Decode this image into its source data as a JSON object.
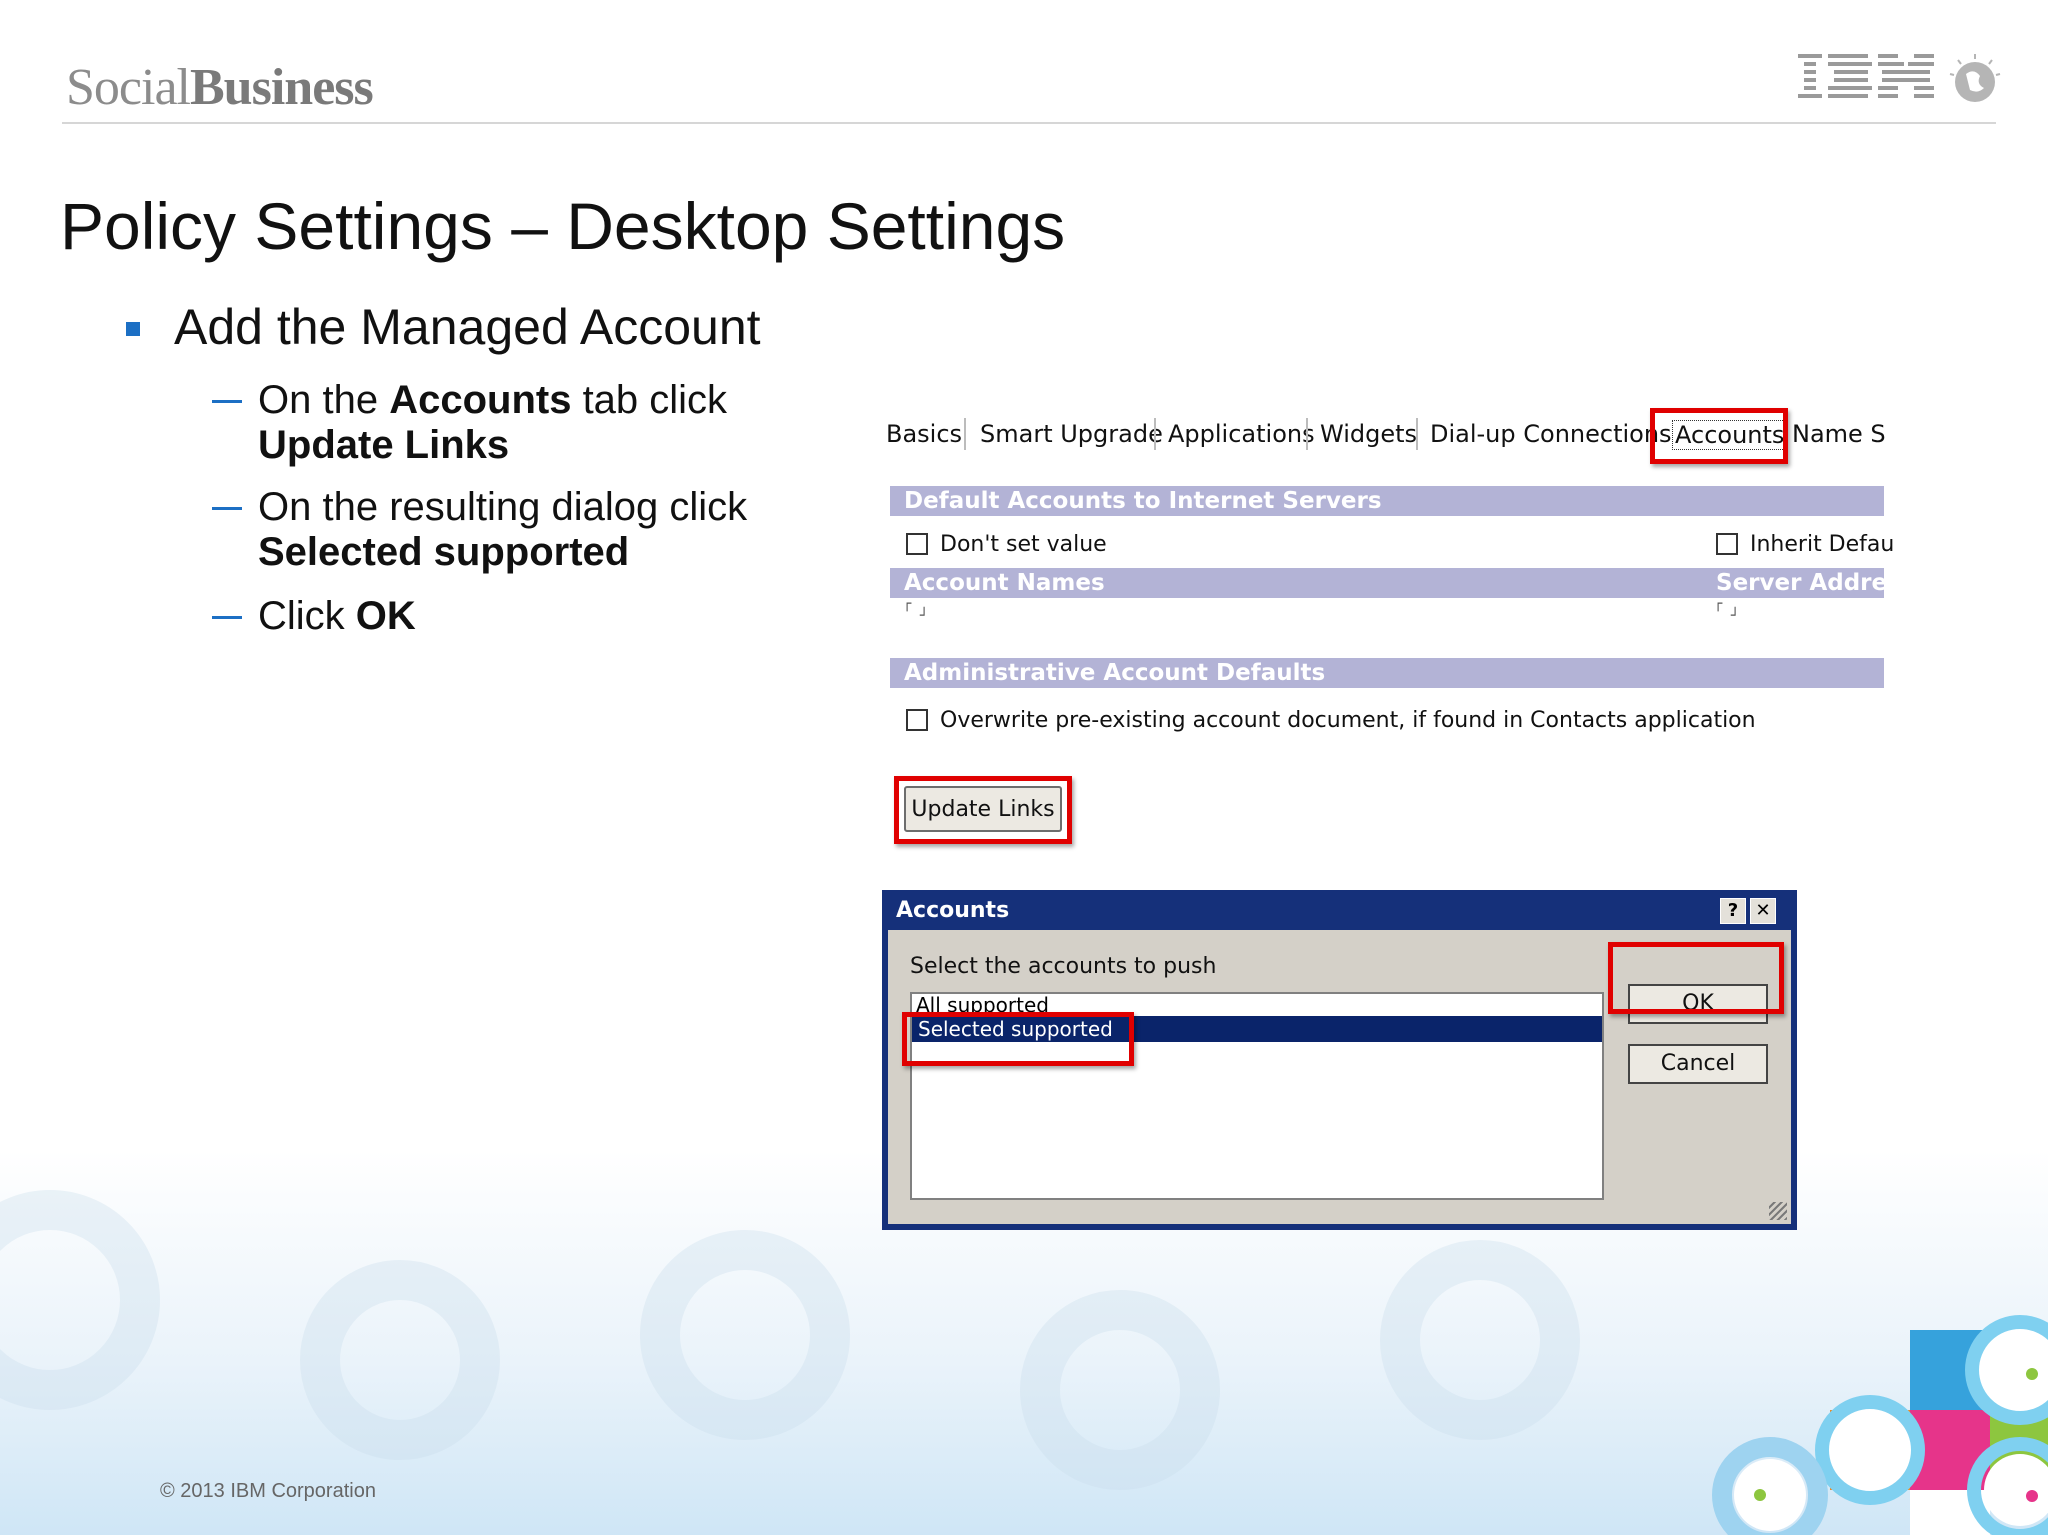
{
  "header": {
    "brand_light": "Social",
    "brand_bold": "Business",
    "logo": "IBM"
  },
  "slide": {
    "title": "Policy Settings – Desktop Settings",
    "bullet": "Add the Managed Account",
    "steps": [
      {
        "pre": "On the ",
        "bold": "Accounts",
        "post": " tab click",
        "bold2": "Update Links"
      },
      {
        "pre": "On the resulting dialog click",
        "bold": "Selected supported"
      },
      {
        "pre": "Click ",
        "bold": "OK"
      }
    ]
  },
  "tabs": [
    "Basics",
    "Smart Upgrade",
    "Applications",
    "Widgets",
    "Dial-up Connections",
    "Accounts",
    "Name Se"
  ],
  "panel": {
    "section1": "Default Accounts to Internet Servers",
    "dont_set": "Don't set value",
    "inherit": "Inherit Defau",
    "col_account_names": "Account Names",
    "col_server_address": "Server Addres",
    "section2": "Administrative Account Defaults",
    "overwrite": "Overwrite pre-existing account document, if found in Contacts application",
    "update_links": "Update Links"
  },
  "dialog": {
    "title": "Accounts",
    "help": "?",
    "close": "✕",
    "prompt": "Select the accounts to push",
    "options": [
      "All supported",
      "Selected supported"
    ],
    "selected": "Selected supported",
    "ok": "OK",
    "cancel": "Cancel"
  },
  "footer": {
    "copyright": "© 2013 IBM Corporation"
  },
  "colors": {
    "accent_blue": "#1c6fc4",
    "highlight_red": "#e00000",
    "section_bar": "#b3b3d6",
    "dialog_title": "#15307a"
  }
}
